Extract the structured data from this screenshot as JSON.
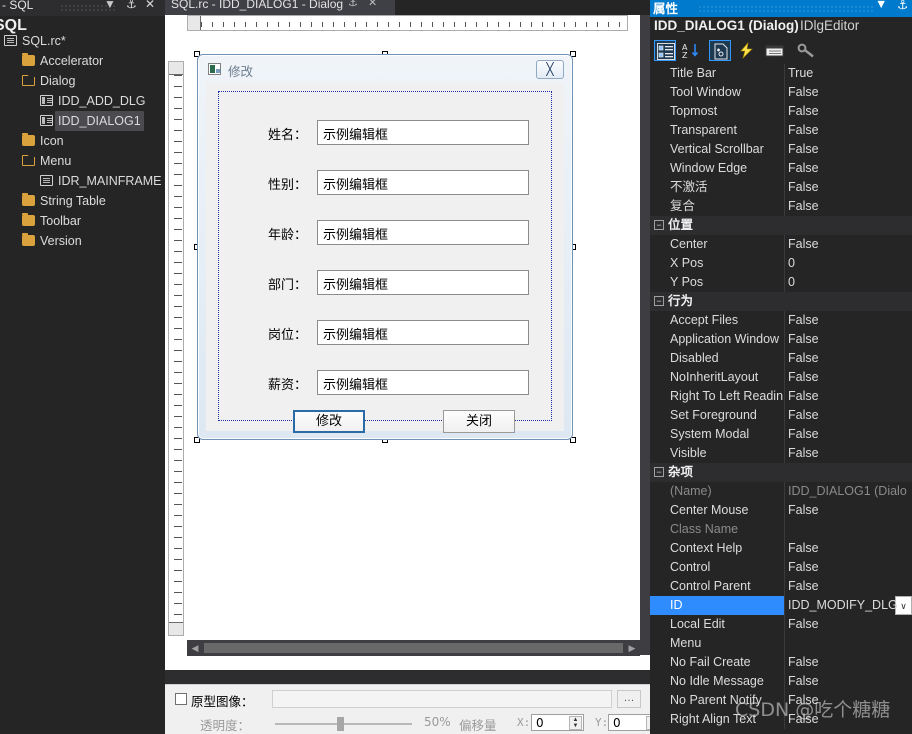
{
  "resource_panel": {
    "title": "- SQL",
    "subtitle": "SQL",
    "icons": {
      "dropdown": "▼",
      "pin": "⚓",
      "close": "✕"
    },
    "tree": [
      {
        "label": "SQL.rc*",
        "icon": "doc-icon",
        "indent": 0,
        "selected": false
      },
      {
        "label": "Accelerator",
        "icon": "folder-icon",
        "indent": 1,
        "selected": false
      },
      {
        "label": "Dialog",
        "icon": "folder-open-icon",
        "indent": 1,
        "selected": false
      },
      {
        "label": "IDD_ADD_DLG",
        "icon": "dialog-icon",
        "indent": 2,
        "selected": false
      },
      {
        "label": "IDD_DIALOG1",
        "icon": "dialog-icon",
        "indent": 2,
        "selected": true
      },
      {
        "label": "Icon",
        "icon": "folder-icon",
        "indent": 1,
        "selected": false
      },
      {
        "label": "Menu",
        "icon": "folder-open-icon",
        "indent": 1,
        "selected": false
      },
      {
        "label": "IDR_MAINFRAME",
        "icon": "menu-icon",
        "indent": 2,
        "selected": false
      },
      {
        "label": "String Table",
        "icon": "folder-icon",
        "indent": 1,
        "selected": false
      },
      {
        "label": "Toolbar",
        "icon": "folder-icon",
        "indent": 1,
        "selected": false
      },
      {
        "label": "Version",
        "icon": "folder-icon",
        "indent": 1,
        "selected": false
      }
    ]
  },
  "editor": {
    "tab_label": "SQL.rc - IDD_DIALOG1 - Dialog",
    "tab_pin_icon": "⚓",
    "tab_close_icon": "✕",
    "dialog": {
      "title": "修改",
      "close_glyph": "╳",
      "fields": [
        {
          "label": "姓名：",
          "value": "示例编辑框"
        },
        {
          "label": "性别：",
          "value": "示例编辑框"
        },
        {
          "label": "年龄：",
          "value": "示例编辑框"
        },
        {
          "label": "部门：",
          "value": "示例编辑框"
        },
        {
          "label": "岗位：",
          "value": "示例编辑框"
        },
        {
          "label": "薪资：",
          "value": "示例编辑框"
        }
      ],
      "buttons": {
        "primary": "修改",
        "secondary": "关闭"
      }
    },
    "scrollbar": {
      "left_arrow": "◀",
      "right_arrow": "▶"
    }
  },
  "prototype_bar": {
    "checkbox_label": "原型图像：",
    "path_value": "",
    "browse_label": "…",
    "transparency_label": "透明度：",
    "transparency_value": "50%",
    "offset_label": "偏移量",
    "x_label": "X:",
    "x_value": "0",
    "y_label": "Y:",
    "y_value": "0",
    "spin_up": "▲",
    "spin_down": "▼"
  },
  "properties": {
    "panel_title": "属性",
    "panel_dropdown_icon": "▼",
    "panel_pin_icon": "⚓",
    "object_name": "IDD_DIALOG1 (Dialog)",
    "object_class": "IDlgEditor",
    "toolbar": [
      {
        "name": "categorized-icon",
        "active": true
      },
      {
        "name": "alphabetical-icon",
        "active": false
      },
      {
        "name": "properties-icon",
        "active": true
      },
      {
        "name": "events-icon",
        "active": false
      },
      {
        "name": "messages-icon",
        "active": false
      },
      {
        "name": "property-pages-icon",
        "active": false
      }
    ],
    "accent_color": "#2f8cff",
    "rows": [
      {
        "name": "Title Bar",
        "value": "True",
        "type": "prop"
      },
      {
        "name": "Tool Window",
        "value": "False",
        "type": "prop"
      },
      {
        "name": "Topmost",
        "value": "False",
        "type": "prop"
      },
      {
        "name": "Transparent",
        "value": "False",
        "type": "prop"
      },
      {
        "name": "Vertical Scrollbar",
        "value": "False",
        "type": "prop"
      },
      {
        "name": "Window Edge",
        "value": "False",
        "type": "prop"
      },
      {
        "name": "不激活",
        "value": "False",
        "type": "prop"
      },
      {
        "name": "复合",
        "value": "False",
        "type": "prop"
      },
      {
        "name": "位置",
        "value": "",
        "type": "category",
        "expander": "−"
      },
      {
        "name": "Center",
        "value": "False",
        "type": "prop"
      },
      {
        "name": "X Pos",
        "value": "0",
        "type": "prop"
      },
      {
        "name": "Y Pos",
        "value": "0",
        "type": "prop"
      },
      {
        "name": "行为",
        "value": "",
        "type": "category",
        "expander": "−"
      },
      {
        "name": "Accept Files",
        "value": "False",
        "type": "prop"
      },
      {
        "name": "Application Window",
        "value": "False",
        "type": "prop"
      },
      {
        "name": "Disabled",
        "value": "False",
        "type": "prop"
      },
      {
        "name": "NoInheritLayout",
        "value": "False",
        "type": "prop"
      },
      {
        "name": "Right To Left Readin",
        "value": "False",
        "type": "prop"
      },
      {
        "name": "Set Foreground",
        "value": "False",
        "type": "prop"
      },
      {
        "name": "System Modal",
        "value": "False",
        "type": "prop"
      },
      {
        "name": "Visible",
        "value": "False",
        "type": "prop"
      },
      {
        "name": "杂项",
        "value": "",
        "type": "category",
        "expander": "−"
      },
      {
        "name": "(Name)",
        "value": "IDD_DIALOG1 (Dialo",
        "type": "prop",
        "dim": true
      },
      {
        "name": "Center Mouse",
        "value": "False",
        "type": "prop"
      },
      {
        "name": "Class Name",
        "value": "",
        "type": "prop",
        "dim": true
      },
      {
        "name": "Context Help",
        "value": "False",
        "type": "prop"
      },
      {
        "name": "Control",
        "value": "False",
        "type": "prop"
      },
      {
        "name": "Control Parent",
        "value": "False",
        "type": "prop"
      },
      {
        "name": "ID",
        "value": "IDD_MODIFY_DLG",
        "type": "prop",
        "selected": true,
        "chevron": "∨"
      },
      {
        "name": "Local Edit",
        "value": "False",
        "type": "prop"
      },
      {
        "name": "Menu",
        "value": "",
        "type": "prop"
      },
      {
        "name": "No Fail Create",
        "value": "False",
        "type": "prop"
      },
      {
        "name": "No Idle Message",
        "value": "False",
        "type": "prop"
      },
      {
        "name": "No Parent Notify",
        "value": "False",
        "type": "prop"
      },
      {
        "name": "Right Align Text",
        "value": "False",
        "type": "prop"
      }
    ]
  },
  "watermark": "CSDN @吃个糖糖"
}
